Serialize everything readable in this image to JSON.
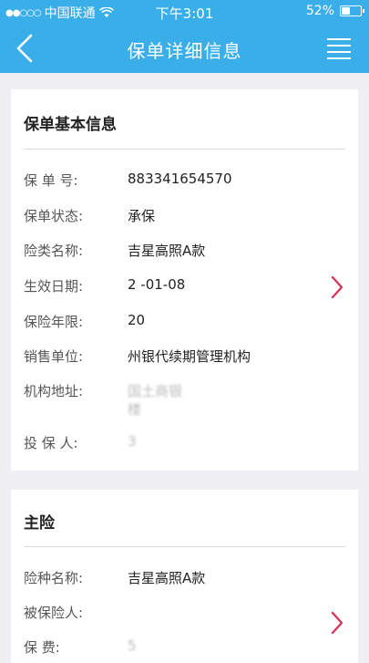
{
  "status": {
    "carrier": "中国联通",
    "time": "下午3:01",
    "battery": "52%",
    "battery_level": 0.52
  },
  "nav": {
    "title": "保单详细信息"
  },
  "basic": {
    "title": "保单基本信息",
    "rows": [
      {
        "label": "保 单 号:",
        "value": "883341654570"
      },
      {
        "label": "保单状态:",
        "value": "承保"
      },
      {
        "label": "险类名称:",
        "value": "吉星高照A款"
      },
      {
        "label": "生效日期:",
        "value": "2   -01-08"
      },
      {
        "label": "保险年限:",
        "value": "20"
      },
      {
        "label": "销售单位:",
        "value": "  州银代续期管理机构"
      },
      {
        "label": "机构地址:",
        "value": "      国土商银",
        "value2": "        楼"
      },
      {
        "label": "投 保 人:",
        "value": "  3  "
      }
    ]
  },
  "main": {
    "title": "主险",
    "rows": [
      {
        "label": "险种名称:",
        "value": "吉星高照A款"
      },
      {
        "label": "被保险人:",
        "value": "  "
      },
      {
        "label": "保      费:",
        "value": "  5"
      }
    ]
  },
  "colors": {
    "accent": "#3aaee8",
    "chevron": "#d8345f"
  }
}
